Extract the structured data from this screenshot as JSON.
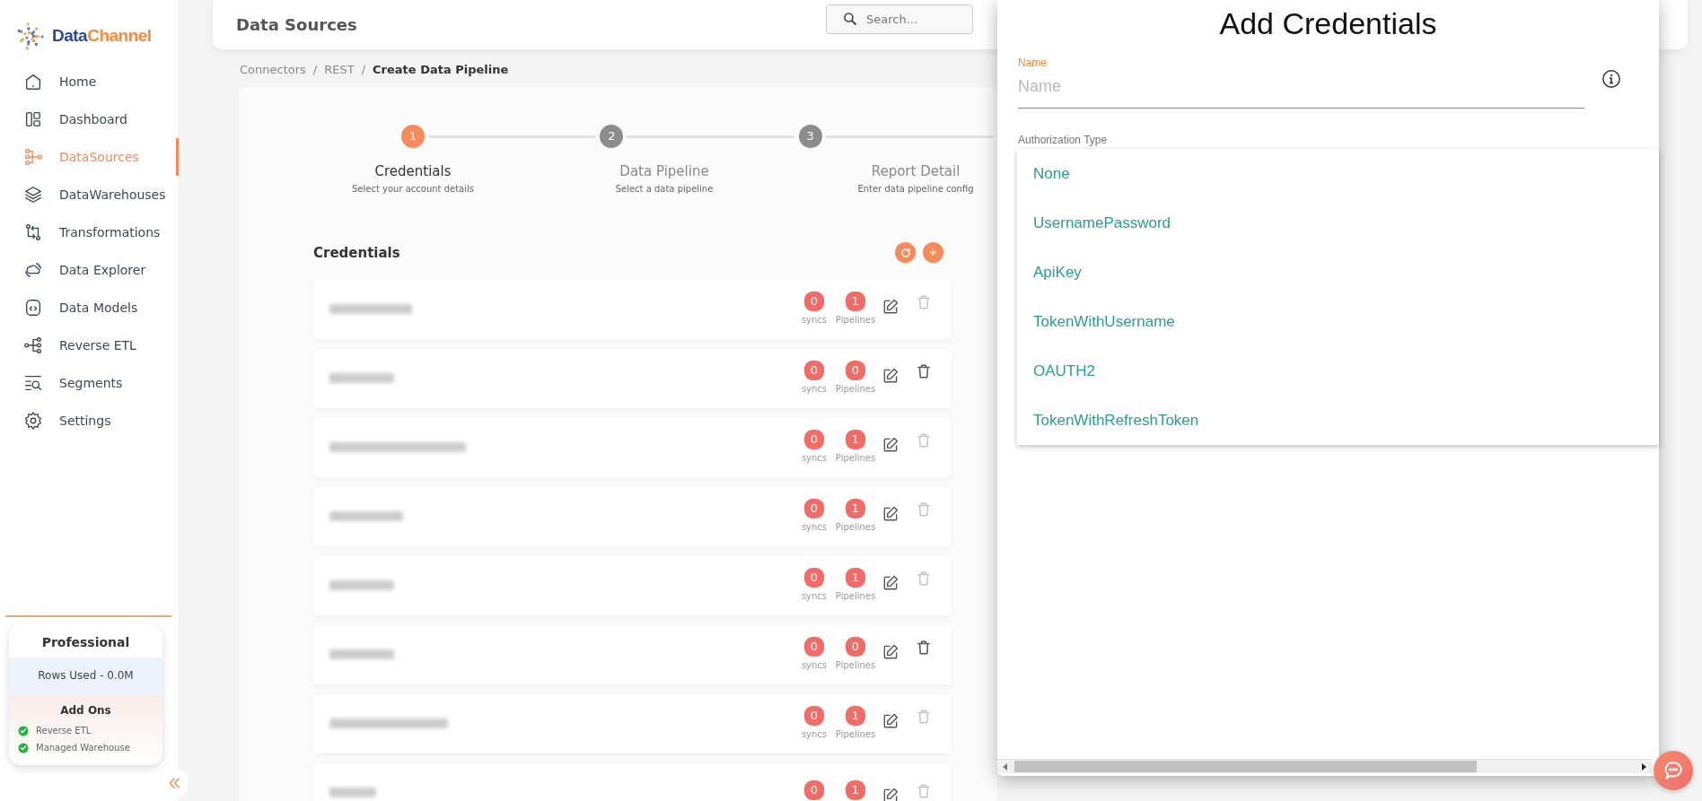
{
  "logo": {
    "first": "Data",
    "second": "Channel"
  },
  "nav": [
    {
      "label": "Home",
      "selected": false
    },
    {
      "label": "Dashboard",
      "selected": false
    },
    {
      "label": "DataSources",
      "selected": true
    },
    {
      "label": "DataWarehouses",
      "selected": false
    },
    {
      "label": "Transformations",
      "selected": false
    },
    {
      "label": "Data Explorer",
      "selected": false
    },
    {
      "label": "Data Models",
      "selected": false
    },
    {
      "label": "Reverse ETL",
      "selected": false
    },
    {
      "label": "Segments",
      "selected": false
    },
    {
      "label": "Settings",
      "selected": false
    }
  ],
  "plan": {
    "title": "Professional",
    "rows_used": "Rows Used - 0.0M",
    "addons_title": "Add Ons",
    "addons": [
      {
        "label": "Reverse ETL",
        "checked": true
      },
      {
        "label": "Managed Warehouse",
        "checked": true
      }
    ]
  },
  "header": {
    "title": "Data Sources",
    "search": {
      "placeholder": "Search..."
    }
  },
  "breadcrumb": [
    {
      "label": "Connectors",
      "selected": false,
      "separator": "/"
    },
    {
      "label": "REST",
      "selected": false,
      "separator": "/"
    },
    {
      "label": "Create Data Pipeline",
      "selected": true
    }
  ],
  "steps": [
    {
      "number": "1",
      "title": "Credentials",
      "subtitle": "Select your account details",
      "selected": true
    },
    {
      "number": "2",
      "title": "Data Pipeline",
      "subtitle": "Select a data pipeline",
      "selected": false
    },
    {
      "number": "3",
      "title": "Report Detail",
      "subtitle": "Enter data pipeline config",
      "selected": false
    }
  ],
  "credentials": {
    "title": "Credentials",
    "rows": [
      {
        "syncs": "0",
        "syncs_label": "syncs",
        "pipelines": "1",
        "pipelines_label": "Pipelines",
        "delete_enabled": false
      },
      {
        "syncs": "0",
        "syncs_label": "syncs",
        "pipelines": "0",
        "pipelines_label": "Pipelines",
        "delete_enabled": true
      },
      {
        "syncs": "0",
        "syncs_label": "syncs",
        "pipelines": "1",
        "pipelines_label": "Pipelines",
        "delete_enabled": false
      },
      {
        "syncs": "0",
        "syncs_label": "syncs",
        "pipelines": "1",
        "pipelines_label": "Pipelines",
        "delete_enabled": false
      },
      {
        "syncs": "0",
        "syncs_label": "syncs",
        "pipelines": "1",
        "pipelines_label": "Pipelines",
        "delete_enabled": false
      },
      {
        "syncs": "0",
        "syncs_label": "syncs",
        "pipelines": "0",
        "pipelines_label": "Pipelines",
        "delete_enabled": true
      },
      {
        "syncs": "0",
        "syncs_label": "syncs",
        "pipelines": "1",
        "pipelines_label": "Pipelines",
        "delete_enabled": false
      },
      {
        "syncs": "0",
        "pipelines": "1",
        "delete_enabled": false
      }
    ]
  },
  "panel": {
    "title": "Add Credentials",
    "name_field": {
      "label": "Name",
      "placeholder": "Name",
      "focused": true
    },
    "auth_label": "Authorization Type",
    "options": [
      {
        "label": "None",
        "selected": false
      },
      {
        "label": "UsernamePassword",
        "selected": false
      },
      {
        "label": "ApiKey",
        "selected": false
      },
      {
        "label": "TokenWithUsername",
        "selected": false
      },
      {
        "label": "OAUTH2",
        "selected": false
      },
      {
        "label": "TokenWithRefreshToken",
        "selected": false
      }
    ]
  }
}
